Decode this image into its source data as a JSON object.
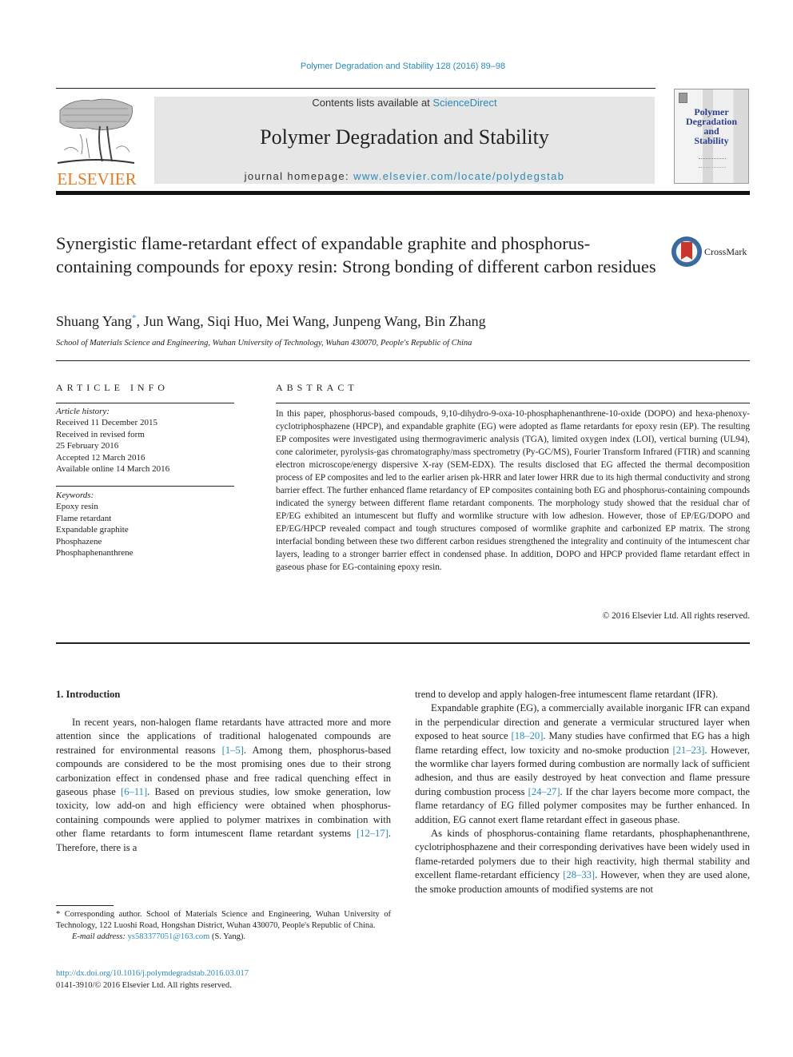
{
  "header": {
    "citation": "Polymer Degradation and Stability 128 (2016) 89–98",
    "contents_prefix": "Contents lists available at ",
    "contents_link": "ScienceDirect",
    "journal_title": "Polymer Degradation and Stability",
    "homepage_prefix": "journal homepage: ",
    "homepage_link": "www.elsevier.com/locate/polydegstab",
    "publisher_wordmark": "ELSEVIER",
    "cover": {
      "title_lines": [
        "Polymer",
        "Degradation",
        "and",
        "Stability"
      ]
    },
    "crossmark_label": "CrossMark"
  },
  "article": {
    "title": "Synergistic flame-retardant effect of expandable graphite and phosphorus-containing compounds for epoxy resin: Strong bonding of different carbon residues",
    "authors": [
      {
        "name": "Shuang Yang",
        "corresponding": true
      },
      {
        "name": "Jun Wang"
      },
      {
        "name": "Siqi Huo"
      },
      {
        "name": "Mei Wang"
      },
      {
        "name": "Junpeng Wang"
      },
      {
        "name": "Bin Zhang"
      }
    ],
    "author_first": "Shuang Yang",
    "author_marker": "*",
    "authors_rest": ", Jun Wang, Siqi Huo, Mei Wang, Junpeng Wang, Bin Zhang",
    "affiliation": "School of Materials Science and Engineering, Wuhan University of Technology, Wuhan 430070, People's Republic of China"
  },
  "article_info": {
    "heading": "ARTICLE INFO",
    "history_label": "Article history:",
    "history": [
      "Received 11 December 2015",
      "Received in revised form",
      "25 February 2016",
      "Accepted 12 March 2016",
      "Available online 14 March 2016"
    ],
    "keywords_label": "Keywords:",
    "keywords": [
      "Epoxy resin",
      "Flame retardant",
      "Expandable graphite",
      "Phosphazene",
      "Phosphaphenanthrene"
    ]
  },
  "abstract": {
    "heading": "ABSTRACT",
    "text": "In this paper, phosphorus-based compouds, 9,10-dihydro-9-oxa-10-phosphaphenanthrene-10-oxide (DOPO) and hexa-phenoxy-cyclotriphosphazene (HPCP), and expandable graphite (EG) were adopted as flame retardants for epoxy resin (EP). The resulting EP composites were investigated using thermogravimeric analysis (TGA), limited oxygen index (LOI), vertical burning (UL94), cone calorimeter, pyrolysis-gas chromatography/mass spectrometry (Py-GC/MS), Fourier Transform Infrared (FTIR) and scanning electron microscope/energy dispersive X-ray (SEM-EDX). The results disclosed that EG affected the thermal decomposition process of EP composites and led to the earlier arisen pk-HRR and later lower HRR due to its high thermal conductivity and strong barrier effect. The further enhanced flame retardancy of EP composites containing both EG and phosphorus-containing compounds indicated the synergy between different flame retardant components. The morphology study showed that the residual char of EP/EG exhibited an intumescent but fluffy and wormlike structure with low adhesion. However, those of EP/EG/DOPO and EP/EG/HPCP revealed compact and tough structures composed of wormlike graphite and carbonized EP matrix. The strong interfacial bonding between these two different carbon residues strengthened the integrality and continuity of the intumescent char layers, leading to a stronger barrier effect in condensed phase. In addition, DOPO and HPCP provided flame retardant effect in gaseous phase for EG-containing epoxy resin.",
    "copyright": "© 2016 Elsevier Ltd. All rights reserved."
  },
  "introduction": {
    "heading": "1.  Introduction",
    "left": {
      "p1_a": "In recent years, non-halogen flame retardants have attracted more and more attention since the applications of traditional halogenated compounds are restrained for environmental reasons ",
      "ref1": "[1–5]",
      "p1_b": ". Among them, phosphorus-based compounds are considered to be the most promising ones due to their strong carbonization effect in condensed phase and free radical quenching effect in gaseous phase ",
      "ref2": "[6–11]",
      "p1_c": ". Based on previous studies, low smoke generation, low toxicity, low add-on and high efficiency were obtained when phosphorus-containing compounds were applied to polymer matrixes in combination with other flame retardants to form intumescent flame retardant systems ",
      "ref3": "[12–17]",
      "p1_d": ". Therefore, there is a"
    },
    "right": {
      "p1_cont": "trend to develop and apply halogen-free intumescent flame retardant (IFR).",
      "p2_a": "Expandable graphite (EG), a commercially available inorganic IFR can expand in the perpendicular direction and generate a vermicular structured layer when exposed to heat source ",
      "ref4": "[18–20]",
      "p2_b": ". Many studies have confirmed that EG has a high flame retarding effect, low toxicity and no-smoke production ",
      "ref5": "[21–23]",
      "p2_c": ". However, the wormlike char layers formed during combustion are normally lack of sufficient adhesion, and thus are easily destroyed by heat convection and flame pressure during combustion process ",
      "ref6": "[24–27]",
      "p2_d": ". If the char layers become more compact, the flame retardancy of EG filled polymer composites may be further enhanced. In addition, EG cannot exert flame retardant effect in gaseous phase.",
      "p3_a": "As kinds of phosphorus-containing flame retardants, phosphaphenanthrene, cyclotriphosphazene and their corresponding derivatives have been widely used in flame-retarded polymers due to their high reactivity, high thermal stability and excellent flame-retardant efficiency ",
      "ref7": "[28–33]",
      "p3_b": ". However, when they are used alone, the smoke production amounts of modified systems are not"
    }
  },
  "footnote": {
    "corresponding": "* Corresponding author. School of Materials Science and Engineering, Wuhan University of Technology, 122 Luoshi Road, Hongshan District, Wuhan 430070, People's Republic of China.",
    "email_label": "E-mail address: ",
    "email": "ys583377051@163.com",
    "email_suffix": " (S. Yang).",
    "doi": "http://dx.doi.org/10.1016/j.polymdegradstab.2016.03.017",
    "issn_copyright": "0141-3910/© 2016 Elsevier Ltd. All rights reserved."
  },
  "colors": {
    "link": "#2a8ab8",
    "elsevier_orange": "#e87a1f",
    "header_band": "#e6e6e6",
    "cover_title": "#2d3f8f"
  }
}
